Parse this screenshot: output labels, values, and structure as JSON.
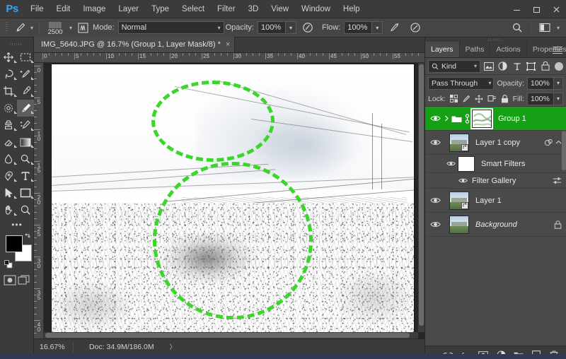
{
  "app": {
    "name": "Adobe Photoshop",
    "logo_text": "Ps"
  },
  "menubar": {
    "items": [
      {
        "label": "File"
      },
      {
        "label": "Edit"
      },
      {
        "label": "Image"
      },
      {
        "label": "Layer"
      },
      {
        "label": "Type"
      },
      {
        "label": "Select"
      },
      {
        "label": "Filter"
      },
      {
        "label": "3D"
      },
      {
        "label": "View"
      },
      {
        "label": "Window"
      },
      {
        "label": "Help"
      }
    ]
  },
  "window_controls": {
    "minimize": "minimize-button",
    "maximize": "maximize-button",
    "close": "close-button"
  },
  "options_bar": {
    "tool": "brush-tool",
    "brush_size": "2500",
    "mode_label": "Mode:",
    "mode_value": "Normal",
    "opacity_label": "Opacity:",
    "opacity_value": "100%",
    "flow_label": "Flow:",
    "flow_value": "100%",
    "airbrush": "airbrush-icon",
    "smoothing": "smoothing-icon",
    "tablet_pressure_opacity": "pressure-opacity-icon",
    "tablet_pressure_size": "pressure-size-icon",
    "search": "search-icon",
    "workspace": "workspace-switcher"
  },
  "document_tab": {
    "title": "IMG_5640.JPG @ 16.7% (Group 1, Layer Mask/8) *",
    "close": "×"
  },
  "toolbar": {
    "tools": [
      {
        "name": "move-tool",
        "has_flyout": true
      },
      {
        "name": "rectangular-marquee-tool",
        "has_flyout": true
      },
      {
        "name": "lasso-tool",
        "has_flyout": true
      },
      {
        "name": "quick-selection-tool",
        "has_flyout": true
      },
      {
        "name": "crop-tool",
        "has_flyout": true
      },
      {
        "name": "eyedropper-tool",
        "has_flyout": true
      },
      {
        "name": "spot-healing-brush-tool",
        "has_flyout": true
      },
      {
        "name": "brush-tool",
        "has_flyout": true,
        "active": true
      },
      {
        "name": "clone-stamp-tool",
        "has_flyout": true
      },
      {
        "name": "history-brush-tool",
        "has_flyout": true
      },
      {
        "name": "eraser-tool",
        "has_flyout": true
      },
      {
        "name": "gradient-tool",
        "has_flyout": true
      },
      {
        "name": "blur-tool",
        "has_flyout": true
      },
      {
        "name": "dodge-tool",
        "has_flyout": true
      },
      {
        "name": "pen-tool",
        "has_flyout": true
      },
      {
        "name": "type-tool",
        "has_flyout": true
      },
      {
        "name": "path-selection-tool",
        "has_flyout": true
      },
      {
        "name": "rectangle-tool",
        "has_flyout": true
      },
      {
        "name": "hand-tool",
        "has_flyout": true
      },
      {
        "name": "zoom-tool",
        "has_flyout": false
      }
    ],
    "more_tools": "•••",
    "foreground_color": "#000000",
    "background_color": "#ffffff",
    "swap_colors": "swap-colors-icon",
    "default_colors": "default-colors-icon",
    "quick_mask": "quick-mask-icon",
    "screen_mode": "screen-mode-icon"
  },
  "rulers": {
    "unit": "cm",
    "horizontal_labels": [
      "0",
      "5",
      "10",
      "15",
      "20",
      "25",
      "30",
      "35",
      "40",
      "45",
      "50",
      "55"
    ],
    "vertical_labels": [
      "0",
      "5",
      "10",
      "15",
      "20",
      "25",
      "30",
      "35",
      "40"
    ]
  },
  "canvas": {
    "description": "Pencil-sketch filtered photo of a stone wall and traditional building with power lines",
    "annotation_color": "#3cd62a",
    "annotations": [
      {
        "name": "annotation-circle-upper",
        "shape": "dashed-ellipse"
      },
      {
        "name": "annotation-circle-lower",
        "shape": "dashed-ellipse"
      }
    ]
  },
  "statusbar": {
    "zoom": "16.67%",
    "doc_info": "Doc: 34.9M/186.0M",
    "expand_arrow": "〉"
  },
  "panel_tabs": [
    {
      "label": "Layers",
      "active": true
    },
    {
      "label": "Paths",
      "active": false
    },
    {
      "label": "Actions",
      "active": false
    },
    {
      "label": "Properties",
      "active": false
    }
  ],
  "layers_panel": {
    "filter": {
      "kind_label": "Kind",
      "icons": [
        "pixel-filter-icon",
        "adjustment-filter-icon",
        "type-filter-icon",
        "shape-filter-icon",
        "smart-object-filter-icon"
      ],
      "toggle": "filter-enable-toggle"
    },
    "blend_mode": "Pass Through",
    "opacity_label": "Opacity:",
    "opacity_value": "100%",
    "lock_label": "Lock:",
    "lock_icons": [
      "lock-transparent-pixels-icon",
      "lock-image-pixels-icon",
      "lock-position-icon",
      "lock-artboard-icon",
      "lock-all-icon"
    ],
    "fill_label": "Fill:",
    "fill_value": "100%",
    "rows": [
      {
        "name": "Group 1",
        "type": "group",
        "selected": true,
        "visible": true,
        "has_mask": true,
        "mask_selected": true,
        "linked": true
      },
      {
        "name": "Layer 1 copy",
        "type": "smart-object",
        "selected": false,
        "visible": true,
        "smart_filter_icon": true,
        "collapse_chevron": "⌃"
      },
      {
        "name": "Smart Filters",
        "type": "smart-filter-header",
        "visible": true
      },
      {
        "name": "Filter Gallery",
        "type": "smart-filter",
        "visible": true,
        "blend_options_icon": true
      },
      {
        "name": "Layer 1",
        "type": "smart-object",
        "selected": false,
        "visible": true
      },
      {
        "name": "Background",
        "type": "background",
        "selected": false,
        "visible": true,
        "locked": true,
        "italic": true
      }
    ],
    "footer_buttons": [
      "link-layers-icon",
      "layer-style-fx-icon",
      "add-layer-mask-icon",
      "new-adjustment-layer-icon",
      "new-group-icon",
      "new-layer-icon",
      "delete-layer-icon"
    ]
  }
}
